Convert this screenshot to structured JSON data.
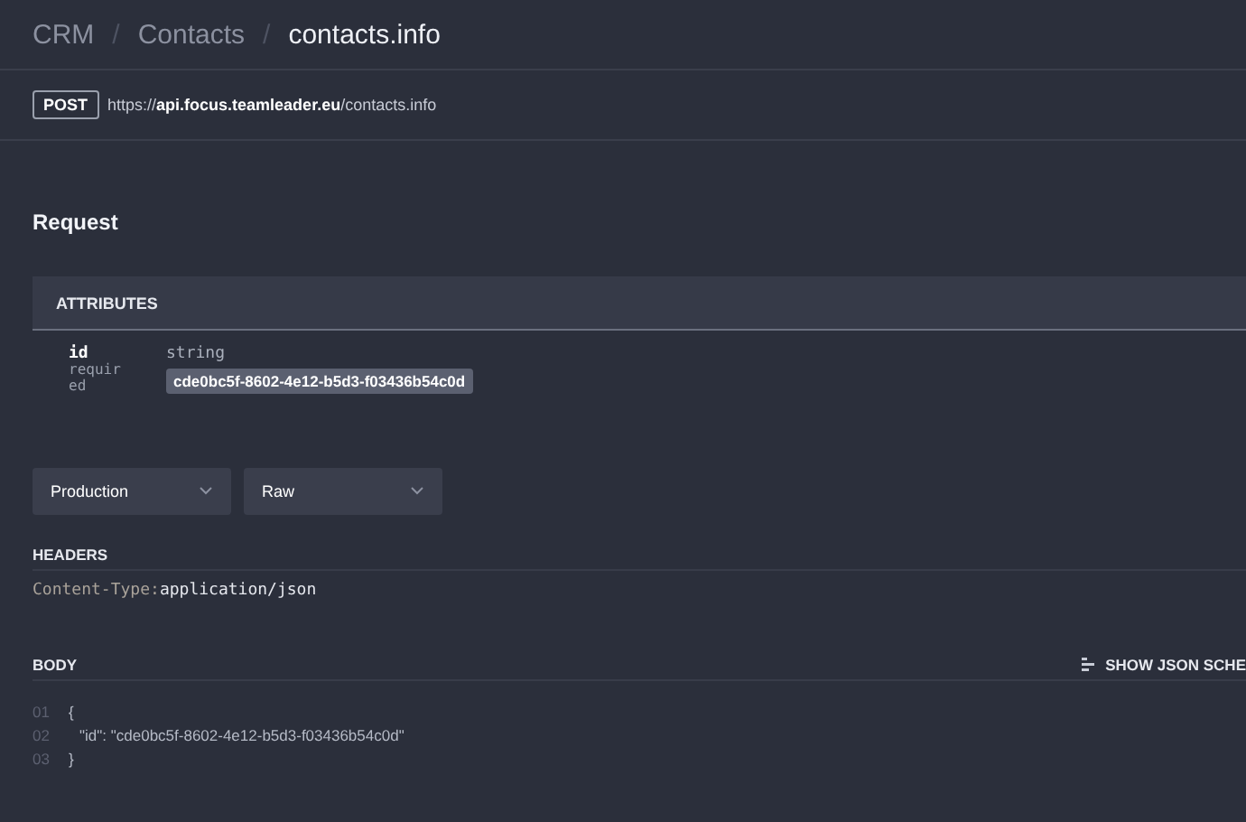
{
  "breadcrumb": [
    {
      "label": "CRM",
      "current": false
    },
    {
      "label": "Contacts",
      "current": false
    },
    {
      "label": "contacts.info",
      "current": true
    }
  ],
  "breadcrumb_separator": "/",
  "endpoint": {
    "method": "POST",
    "url_prefix": "https://",
    "url_host": "api.focus.teamleader.eu",
    "url_path": "/contacts.info"
  },
  "request": {
    "title": "Request",
    "attributes": {
      "title": "ATTRIBUTES",
      "items": [
        {
          "name": "id",
          "requirement": "required",
          "type": "string",
          "value": "cde0bc5f-8602-4e12-b5d3-f03436b54c0d"
        }
      ]
    },
    "dropdowns": [
      {
        "value": "Production"
      },
      {
        "value": "Raw"
      }
    ],
    "headers": {
      "title": "HEADERS",
      "items": [
        {
          "key": "Content-Type",
          "separator": ":",
          "value": "application/json"
        }
      ]
    },
    "body": {
      "title": "BODY",
      "schema_button": "SHOW JSON SCHE",
      "lines": [
        {
          "number": "01",
          "code": "{",
          "indent": false
        },
        {
          "number": "02",
          "code": "\"id\": \"cde0bc5f-8602-4e12-b5d3-f03436b54c0d\"",
          "indent": true
        },
        {
          "number": "03",
          "code": "}",
          "indent": false
        }
      ]
    }
  }
}
